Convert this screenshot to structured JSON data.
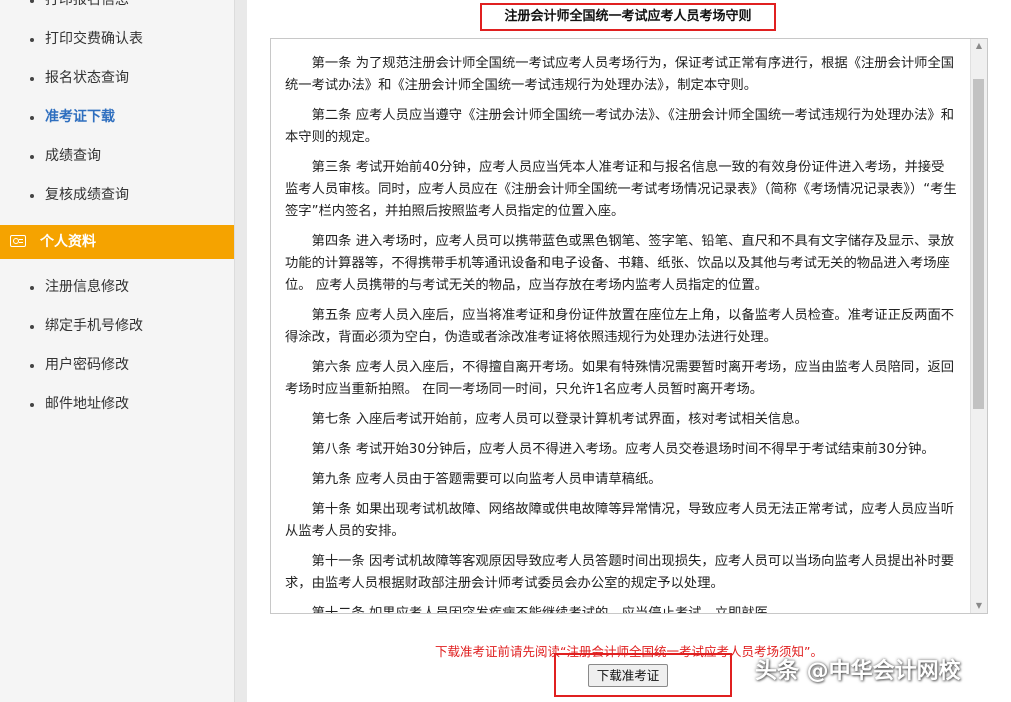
{
  "sidebar": {
    "items_top": [
      {
        "label": "打印报名信息"
      },
      {
        "label": "打印交费确认表"
      },
      {
        "label": "报名状态查询"
      },
      {
        "label": "准考证下载",
        "active": true
      },
      {
        "label": "成绩查询"
      },
      {
        "label": "复核成绩查询"
      }
    ],
    "section_title": "个人资料",
    "section_icon": "id-card-icon",
    "items_bottom": [
      {
        "label": "注册信息修改"
      },
      {
        "label": "绑定手机号修改"
      },
      {
        "label": "用户密码修改"
      },
      {
        "label": "邮件地址修改"
      }
    ]
  },
  "main": {
    "title": "注册会计师全国统一考试应考人员考场守则",
    "rules": [
      "第一条 为了规范注册会计师全国统一考试应考人员考场行为，保证考试正常有序进行，根据《注册会计师全国统一考试办法》和《注册会计师全国统一考试违规行为处理办法》，制定本守则。",
      "第二条 应考人员应当遵守《注册会计师全国统一考试办法》、《注册会计师全国统一考试违规行为处理办法》和本守则的规定。",
      "第三条 考试开始前40分钟，应考人员应当凭本人准考证和与报名信息一致的有效身份证件进入考场，并接受监考人员审核。同时，应考人员应在《注册会计师全国统一考试考场情况记录表》（简称《考场情况记录表》）“考生签字”栏内签名，并拍照后按照监考人员指定的位置入座。",
      "第四条 进入考场时，应考人员可以携带蓝色或黑色钢笔、签字笔、铅笔、直尺和不具有文字储存及显示、录放功能的计算器等，不得携带手机等通讯设备和电子设备、书籍、纸张、饮品以及其他与考试无关的物品进入考场座位。 应考人员携带的与考试无关的物品，应当存放在考场内监考人员指定的位置。",
      "第五条 应考人员入座后，应当将准考证和身份证件放置在座位左上角，以备监考人员检查。准考证正反两面不得涂改，背面必须为空白，伪造或者涂改准考证将依照违规行为处理办法进行处理。",
      "第六条 应考人员入座后，不得擅自离开考场。如果有特殊情况需要暂时离开考场，应当由监考人员陪同，返回考场时应当重新拍照。 在同一考场同一时间，只允许1名应考人员暂时离开考场。",
      "第七条 入座后考试开始前，应考人员可以登录计算机考试界面，核对考试相关信息。",
      "第八条 考试开始30分钟后，应考人员不得进入考场。应考人员交卷退场时间不得早于考试结束前30分钟。",
      "第九条 应考人员由于答题需要可以向监考人员申请草稿纸。",
      "第十条 如果出现考试机故障、网络故障或供电故障等异常情况，导致应考人员无法正常考试，应考人员应当听从监考人员的安排。",
      "第十一条 因考试机故障等客观原因导致应考人员答题时间出现损失，应考人员可以当场向监考人员提出补时要求，由监考人员根据财政部注册会计师考试委员会办公室的规定予以处理。",
      "第十二条 如果应考人员因突发疾病不能继续考试的，应当停止考试，立即就医。"
    ],
    "scroll_position": 0.12,
    "notice": "下载准考证前请先阅读“注册会计师全国统一考试应考人员考场须知”。",
    "download_button": "下载准考证"
  },
  "watermark": "头条 @中华会计网校"
}
